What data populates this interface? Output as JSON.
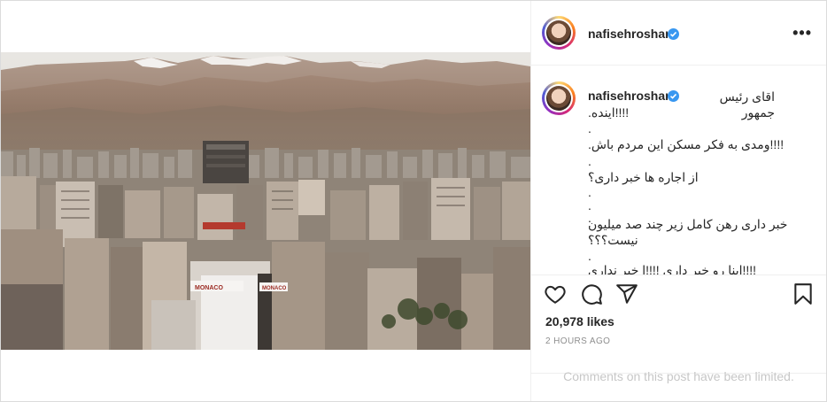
{
  "post": {
    "username": "nafisehroshan",
    "verified_icon": "verified-badge-icon",
    "more_icon": "more-options-icon",
    "caption_lines": [
      "اقای رئیس جمهور",
      "!!!!اینده.",
      ".",
      "!!!!ومدی به فکر مسکن این مردم باش.",
      ".",
      "از اجاره ها خبر داری؟",
      ".",
      ".",
      ".",
      "خبر داری رهن کامل زیر چند صد میلیون",
      "نیست؟؟؟",
      ".",
      "!!!!اینا رو خبر داری !!!!ا خبر نداری"
    ],
    "likes": "20,978 likes",
    "time": "2 HOURS AGO",
    "comments_notice": "Comments on this post have been limited.",
    "icons": {
      "like": "heart-icon",
      "comment": "comment-icon",
      "share": "share-icon",
      "save": "bookmark-icon"
    },
    "photo_sign": "MONACO"
  }
}
